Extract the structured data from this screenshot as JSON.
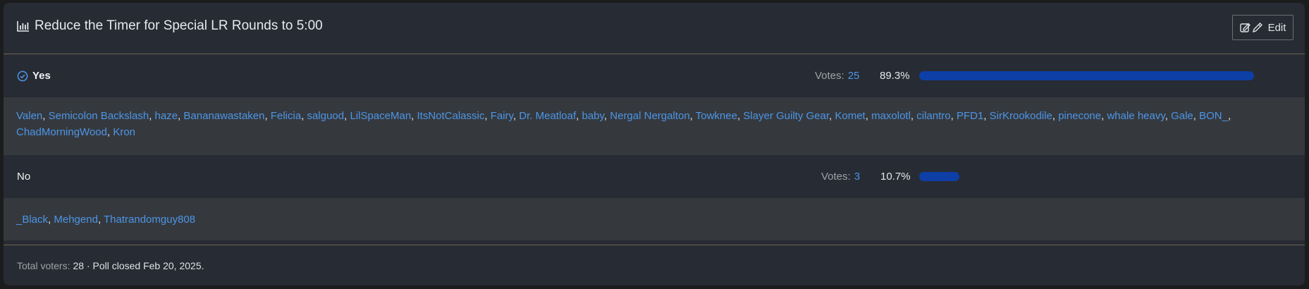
{
  "poll": {
    "title": "Reduce the Timer for Special LR Rounds to 5:00",
    "edit_label": "Edit"
  },
  "options": [
    {
      "label": "Yes",
      "selected": true,
      "votes_label": "Votes:",
      "votes": "25",
      "percent": "89.3%",
      "fill_fraction": 0.893,
      "voters": [
        "Valen",
        "Semicolon Backslash",
        "haze",
        "Bananawastaken",
        "Felicia",
        "salguod",
        "LilSpaceMan",
        "ItsNotCalassic",
        "Fairy",
        "Dr. Meatloaf",
        "baby",
        "Nergal Nergalton",
        "Towknee",
        "Slayer Guilty Gear",
        "Komet",
        "maxolotl",
        "cilantro",
        "PFD1",
        "SirKrookodile",
        "pinecone",
        "whale heavy",
        "Gale",
        "BON_",
        "ChadMorningWood",
        "Kron"
      ]
    },
    {
      "label": "No",
      "selected": false,
      "votes_label": "Votes:",
      "votes": "3",
      "percent": "10.7%",
      "fill_fraction": 0.107,
      "voters": [
        "_Black",
        "Mehgend",
        "Thatrandomguy808"
      ]
    }
  ],
  "footer": {
    "total_label": "Total voters:",
    "total": "28 · Poll closed Feb 20, 2025."
  },
  "colors": {
    "accent": "#4d95e6",
    "bar": "#0d3fa6",
    "panel": "#272b33",
    "voters_bg": "#35393e"
  },
  "icons": {
    "title": "bar-chart-icon",
    "edit": "edit-icon",
    "selected": "check-circle-icon"
  }
}
